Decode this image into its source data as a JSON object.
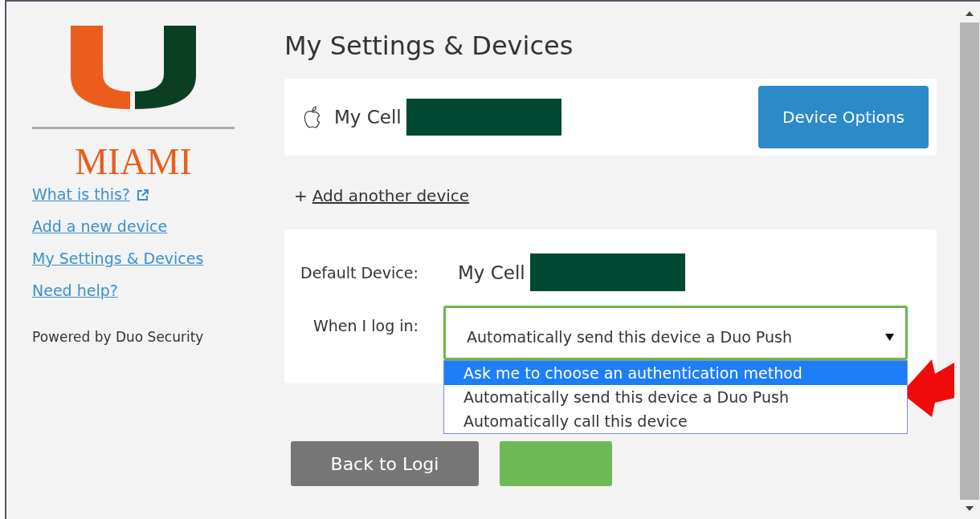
{
  "sidebar": {
    "logo_text": "MIAMI",
    "links": [
      {
        "label": "What is this?",
        "external": true
      },
      {
        "label": "Add a new device",
        "external": false
      },
      {
        "label": "My Settings & Devices",
        "external": false
      },
      {
        "label": "Need help?",
        "external": false
      }
    ],
    "footer": "Powered by Duo Security"
  },
  "main": {
    "title": "My Settings & Devices",
    "device": {
      "name": "My Cell",
      "button": "Device Options"
    },
    "add_link": {
      "prefix": "+",
      "label": "Add another device"
    },
    "settings": {
      "default_label": "Default Device:",
      "default_value": "My Cell",
      "login_label": "When I log in:",
      "select_value": "Automatically send this device a Duo Push",
      "options": [
        {
          "label": "Ask me to choose an authentication method",
          "selected": true
        },
        {
          "label": "Automatically send this device a Duo Push",
          "selected": false
        },
        {
          "label": "Automatically call this device",
          "selected": false
        }
      ]
    },
    "buttons": [
      {
        "kind": "back",
        "label": "Back to Logi"
      },
      {
        "kind": "saved"
      }
    ]
  }
}
